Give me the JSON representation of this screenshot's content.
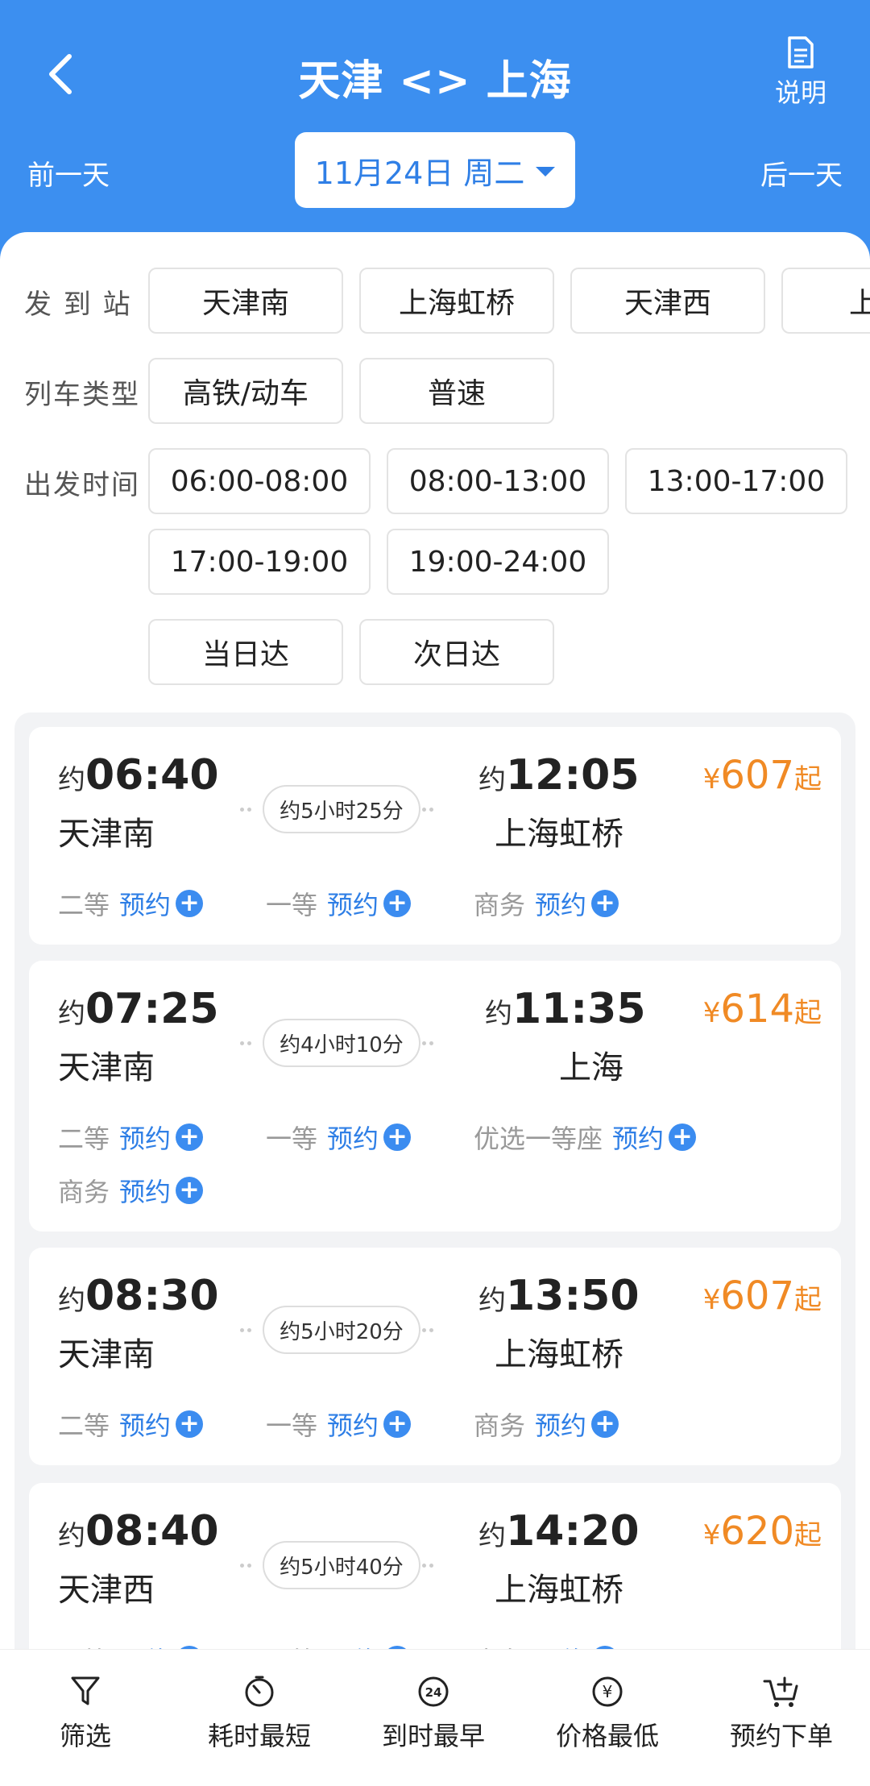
{
  "header": {
    "title": "天津 <> 上海",
    "explain_label": "说明",
    "prev_day": "前一天",
    "next_day": "后一天",
    "date": "11月24日 周二"
  },
  "filters": {
    "station_label": "发 到 站",
    "stations": [
      "天津南",
      "上海虹桥",
      "天津西",
      "上"
    ],
    "type_label": "列车类型",
    "types": [
      "高铁/动车",
      "普速"
    ],
    "time_label": "出发时间",
    "times": [
      "06:00-08:00",
      "08:00-13:00",
      "13:00-17:00",
      "17:00-19:00",
      "19:00-24:00"
    ],
    "arrivals": [
      "当日达",
      "次日达"
    ]
  },
  "common": {
    "approx": "约",
    "book": "预约",
    "yen": "¥",
    "from": "起"
  },
  "trains": [
    {
      "dep_time": "06:40",
      "dep_station": "天津南",
      "arr_time": "12:05",
      "arr_station": "上海虹桥",
      "duration": "约5小时25分",
      "price": "607",
      "seats": [
        "二等",
        "一等",
        "商务"
      ]
    },
    {
      "dep_time": "07:25",
      "dep_station": "天津南",
      "arr_time": "11:35",
      "arr_station": "上海",
      "duration": "约4小时10分",
      "price": "614",
      "seats": [
        "二等",
        "一等",
        "优选一等座",
        "商务"
      ]
    },
    {
      "dep_time": "08:30",
      "dep_station": "天津南",
      "arr_time": "13:50",
      "arr_station": "上海虹桥",
      "duration": "约5小时20分",
      "price": "607",
      "seats": [
        "二等",
        "一等",
        "商务"
      ]
    },
    {
      "dep_time": "08:40",
      "dep_station": "天津西",
      "arr_time": "14:20",
      "arr_station": "上海虹桥",
      "duration": "约5小时40分",
      "price": "620",
      "seats": [
        "二等",
        "一等",
        "商务"
      ]
    }
  ],
  "bottom_tabs": [
    {
      "label": "筛选",
      "icon": "filter-icon"
    },
    {
      "label": "耗时最短",
      "icon": "timer-icon"
    },
    {
      "label": "到时最早",
      "icon": "clock-24-icon"
    },
    {
      "label": "价格最低",
      "icon": "yen-coin-icon"
    },
    {
      "label": "预约下单",
      "icon": "cart-add-icon"
    }
  ],
  "colors": {
    "brand_blue": "#3c8ff0",
    "price_orange": "#f08a25",
    "link_blue": "#2f7fe6"
  }
}
